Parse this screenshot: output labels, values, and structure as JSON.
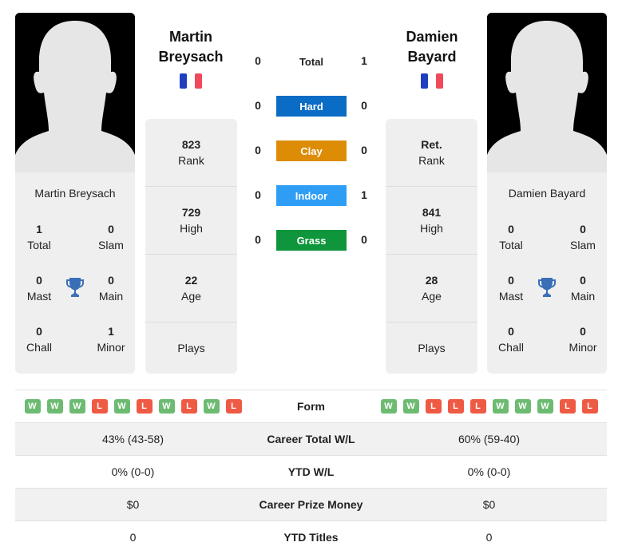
{
  "players": [
    {
      "name": "Martin Breysach",
      "name_line1": "Martin",
      "name_line2": "Breysach",
      "country_flag": "france-flag",
      "titles": {
        "total": {
          "value": "1",
          "label": "Total"
        },
        "slam": {
          "value": "0",
          "label": "Slam"
        },
        "mast": {
          "value": "0",
          "label": "Mast"
        },
        "main": {
          "value": "0",
          "label": "Main"
        },
        "chall": {
          "value": "0",
          "label": "Chall"
        },
        "minor": {
          "value": "1",
          "label": "Minor"
        }
      },
      "stats": {
        "rank": {
          "value": "823",
          "label": "Rank"
        },
        "high": {
          "value": "729",
          "label": "High"
        },
        "age": {
          "value": "22",
          "label": "Age"
        },
        "plays": {
          "value": "",
          "label": "Plays"
        }
      },
      "form": [
        "W",
        "W",
        "W",
        "L",
        "W",
        "L",
        "W",
        "L",
        "W",
        "L"
      ]
    },
    {
      "name": "Damien Bayard",
      "name_line1": "Damien",
      "name_line2": "Bayard",
      "country_flag": "france-flag",
      "titles": {
        "total": {
          "value": "0",
          "label": "Total"
        },
        "slam": {
          "value": "0",
          "label": "Slam"
        },
        "mast": {
          "value": "0",
          "label": "Mast"
        },
        "main": {
          "value": "0",
          "label": "Main"
        },
        "chall": {
          "value": "0",
          "label": "Chall"
        },
        "minor": {
          "value": "0",
          "label": "Minor"
        }
      },
      "stats": {
        "rank": {
          "value": "Ret.",
          "label": "Rank"
        },
        "high": {
          "value": "841",
          "label": "High"
        },
        "age": {
          "value": "28",
          "label": "Age"
        },
        "plays": {
          "value": "",
          "label": "Plays"
        }
      },
      "form": [
        "W",
        "W",
        "L",
        "L",
        "L",
        "W",
        "W",
        "W",
        "L",
        "L"
      ]
    }
  ],
  "surfaces": [
    {
      "key": "total",
      "label": "Total",
      "p1": "0",
      "p2": "1",
      "color": ""
    },
    {
      "key": "hard",
      "label": "Hard",
      "p1": "0",
      "p2": "0",
      "color": "#0a6cc4"
    },
    {
      "key": "clay",
      "label": "Clay",
      "p1": "0",
      "p2": "0",
      "color": "#dd8c06"
    },
    {
      "key": "indoor",
      "label": "Indoor",
      "p1": "0",
      "p2": "1",
      "color": "#2e9ef5"
    },
    {
      "key": "grass",
      "label": "Grass",
      "p1": "0",
      "p2": "0",
      "color": "#0f953c"
    }
  ],
  "comparison": {
    "form_label": "Form",
    "rows": [
      {
        "label": "Career Total W/L",
        "p1": "43% (43-58)",
        "p2": "60% (59-40)"
      },
      {
        "label": "YTD W/L",
        "p1": "0% (0-0)",
        "p2": "0% (0-0)"
      },
      {
        "label": "Career Prize Money",
        "p1": "$0",
        "p2": "$0"
      },
      {
        "label": "YTD Titles",
        "p1": "0",
        "p2": "0"
      }
    ]
  },
  "colors": {
    "win": "#6dbb72",
    "loss": "#ee5a44",
    "trophy": "#3a6fb7",
    "flag_blue": "#1f3fbf",
    "flag_red": "#f04a5a"
  }
}
